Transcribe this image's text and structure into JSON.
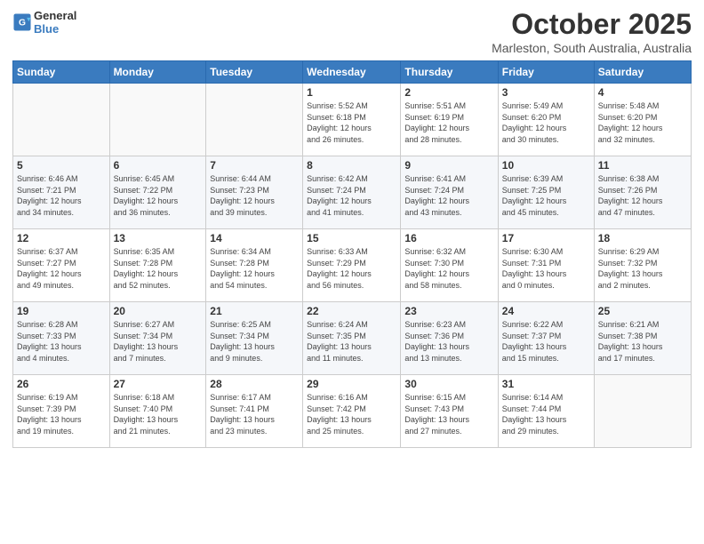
{
  "logo": {
    "line1": "General",
    "line2": "Blue"
  },
  "title": "October 2025",
  "location": "Marleston, South Australia, Australia",
  "days_header": [
    "Sunday",
    "Monday",
    "Tuesday",
    "Wednesday",
    "Thursday",
    "Friday",
    "Saturday"
  ],
  "weeks": [
    [
      {
        "day": "",
        "info": ""
      },
      {
        "day": "",
        "info": ""
      },
      {
        "day": "",
        "info": ""
      },
      {
        "day": "1",
        "info": "Sunrise: 5:52 AM\nSunset: 6:18 PM\nDaylight: 12 hours\nand 26 minutes."
      },
      {
        "day": "2",
        "info": "Sunrise: 5:51 AM\nSunset: 6:19 PM\nDaylight: 12 hours\nand 28 minutes."
      },
      {
        "day": "3",
        "info": "Sunrise: 5:49 AM\nSunset: 6:20 PM\nDaylight: 12 hours\nand 30 minutes."
      },
      {
        "day": "4",
        "info": "Sunrise: 5:48 AM\nSunset: 6:20 PM\nDaylight: 12 hours\nand 32 minutes."
      }
    ],
    [
      {
        "day": "5",
        "info": "Sunrise: 6:46 AM\nSunset: 7:21 PM\nDaylight: 12 hours\nand 34 minutes."
      },
      {
        "day": "6",
        "info": "Sunrise: 6:45 AM\nSunset: 7:22 PM\nDaylight: 12 hours\nand 36 minutes."
      },
      {
        "day": "7",
        "info": "Sunrise: 6:44 AM\nSunset: 7:23 PM\nDaylight: 12 hours\nand 39 minutes."
      },
      {
        "day": "8",
        "info": "Sunrise: 6:42 AM\nSunset: 7:24 PM\nDaylight: 12 hours\nand 41 minutes."
      },
      {
        "day": "9",
        "info": "Sunrise: 6:41 AM\nSunset: 7:24 PM\nDaylight: 12 hours\nand 43 minutes."
      },
      {
        "day": "10",
        "info": "Sunrise: 6:39 AM\nSunset: 7:25 PM\nDaylight: 12 hours\nand 45 minutes."
      },
      {
        "day": "11",
        "info": "Sunrise: 6:38 AM\nSunset: 7:26 PM\nDaylight: 12 hours\nand 47 minutes."
      }
    ],
    [
      {
        "day": "12",
        "info": "Sunrise: 6:37 AM\nSunset: 7:27 PM\nDaylight: 12 hours\nand 49 minutes."
      },
      {
        "day": "13",
        "info": "Sunrise: 6:35 AM\nSunset: 7:28 PM\nDaylight: 12 hours\nand 52 minutes."
      },
      {
        "day": "14",
        "info": "Sunrise: 6:34 AM\nSunset: 7:28 PM\nDaylight: 12 hours\nand 54 minutes."
      },
      {
        "day": "15",
        "info": "Sunrise: 6:33 AM\nSunset: 7:29 PM\nDaylight: 12 hours\nand 56 minutes."
      },
      {
        "day": "16",
        "info": "Sunrise: 6:32 AM\nSunset: 7:30 PM\nDaylight: 12 hours\nand 58 minutes."
      },
      {
        "day": "17",
        "info": "Sunrise: 6:30 AM\nSunset: 7:31 PM\nDaylight: 13 hours\nand 0 minutes."
      },
      {
        "day": "18",
        "info": "Sunrise: 6:29 AM\nSunset: 7:32 PM\nDaylight: 13 hours\nand 2 minutes."
      }
    ],
    [
      {
        "day": "19",
        "info": "Sunrise: 6:28 AM\nSunset: 7:33 PM\nDaylight: 13 hours\nand 4 minutes."
      },
      {
        "day": "20",
        "info": "Sunrise: 6:27 AM\nSunset: 7:34 PM\nDaylight: 13 hours\nand 7 minutes."
      },
      {
        "day": "21",
        "info": "Sunrise: 6:25 AM\nSunset: 7:34 PM\nDaylight: 13 hours\nand 9 minutes."
      },
      {
        "day": "22",
        "info": "Sunrise: 6:24 AM\nSunset: 7:35 PM\nDaylight: 13 hours\nand 11 minutes."
      },
      {
        "day": "23",
        "info": "Sunrise: 6:23 AM\nSunset: 7:36 PM\nDaylight: 13 hours\nand 13 minutes."
      },
      {
        "day": "24",
        "info": "Sunrise: 6:22 AM\nSunset: 7:37 PM\nDaylight: 13 hours\nand 15 minutes."
      },
      {
        "day": "25",
        "info": "Sunrise: 6:21 AM\nSunset: 7:38 PM\nDaylight: 13 hours\nand 17 minutes."
      }
    ],
    [
      {
        "day": "26",
        "info": "Sunrise: 6:19 AM\nSunset: 7:39 PM\nDaylight: 13 hours\nand 19 minutes."
      },
      {
        "day": "27",
        "info": "Sunrise: 6:18 AM\nSunset: 7:40 PM\nDaylight: 13 hours\nand 21 minutes."
      },
      {
        "day": "28",
        "info": "Sunrise: 6:17 AM\nSunset: 7:41 PM\nDaylight: 13 hours\nand 23 minutes."
      },
      {
        "day": "29",
        "info": "Sunrise: 6:16 AM\nSunset: 7:42 PM\nDaylight: 13 hours\nand 25 minutes."
      },
      {
        "day": "30",
        "info": "Sunrise: 6:15 AM\nSunset: 7:43 PM\nDaylight: 13 hours\nand 27 minutes."
      },
      {
        "day": "31",
        "info": "Sunrise: 6:14 AM\nSunset: 7:44 PM\nDaylight: 13 hours\nand 29 minutes."
      },
      {
        "day": "",
        "info": ""
      }
    ]
  ]
}
